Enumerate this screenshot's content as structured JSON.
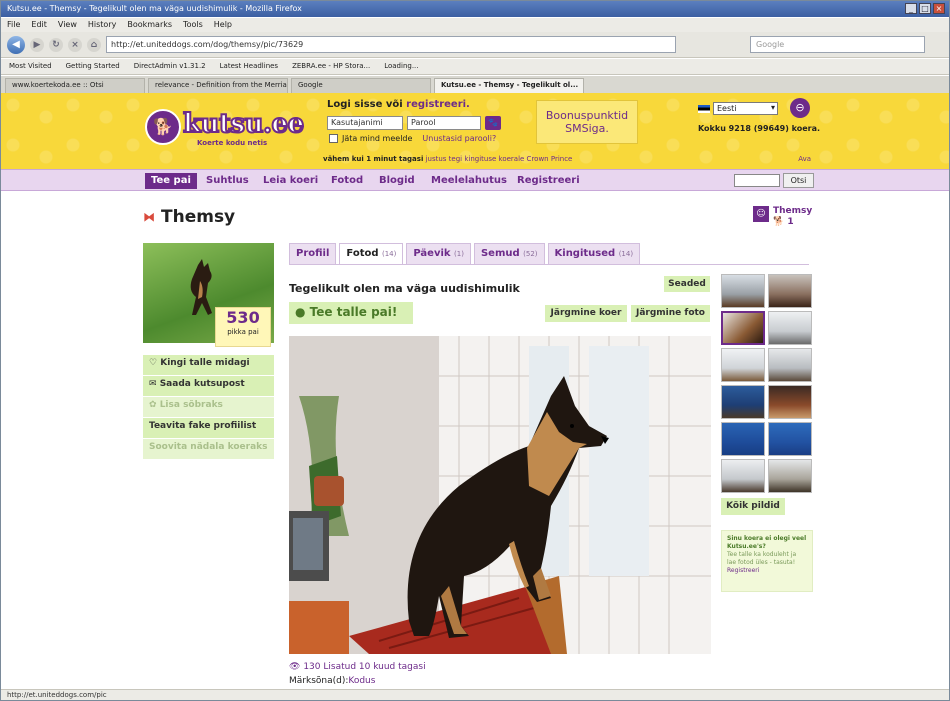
{
  "browser": {
    "title": "Kutsu.ee - Themsy - Tegelikult olen ma väga uudishimulik - Mozilla Firefox",
    "menu": [
      "File",
      "Edit",
      "View",
      "History",
      "Bookmarks",
      "Tools",
      "Help"
    ],
    "url": "http://et.uniteddogs.com/dog/themsy/pic/73629",
    "search_placeholder": "Google",
    "bookmarks": [
      "Most Visited",
      "Getting Started",
      "DirectAdmin v1.31.2",
      "Latest Headlines",
      "ZEBRA.ee - HP Stora...",
      "Loading..."
    ],
    "tabs": [
      "www.koertekoda.ee :: Otsi",
      "relevance - Definition from the Merriam...",
      "Google",
      "Kutsu.ee - Themsy - Tegelikult ol..."
    ],
    "status": "http://et.uniteddogs.com/pic"
  },
  "header": {
    "logo": "kutsu.ee",
    "tagline": "Koerte kodu netis",
    "login_title": "Logi sisse või",
    "register_link": "registreeri.",
    "username_placeholder": "Kasutajanimi",
    "password_placeholder": "Parool",
    "remember": "Jäta mind meelde",
    "forgot": "Unustasid parooli?",
    "bonus_line1": "Boonuspunktid",
    "bonus_line2": "SMSiga.",
    "language": "Eesti",
    "dog_count": "Kokku 9218 (99649) koera.",
    "ticker_time": "vähem kui 1 minut tagasi",
    "ticker_text": "justus tegi kingituse koerale Crown Prince",
    "ticker_more": "Ava"
  },
  "nav": {
    "items": [
      "Tee pai",
      "Suhtlus",
      "Leia koeri",
      "Fotod",
      "Blogid",
      "Meelelahutus",
      "Registreeri"
    ],
    "search_button": "Otsi"
  },
  "profile": {
    "name": "Themsy",
    "badge_name": "Themsy",
    "badge_count": "1",
    "score": "530",
    "score_label": "pikka pai",
    "actions": [
      "Kingi talle midagi",
      "Saada kutsupost",
      "Lisa sõbraks",
      "Teavita fake profiilist",
      "Soovita nädala koeraks"
    ]
  },
  "tabs": [
    {
      "label": "Profiil",
      "count": ""
    },
    {
      "label": "Fotod",
      "count": "(14)"
    },
    {
      "label": "Päevik",
      "count": "(1)"
    },
    {
      "label": "Semud",
      "count": "(52)"
    },
    {
      "label": "Kingitused",
      "count": "(14)"
    }
  ],
  "photo": {
    "title": "Tegelikult olen ma väga uudishimulik",
    "settings": "Seaded",
    "pet_button": "Tee talle pai!",
    "next_dog": "Järgmine koer",
    "next_photo": "Järgmine foto",
    "views": "130",
    "added": "Lisatud 10 kuud tagasi",
    "keywords_label": "Märksõna(d):",
    "keyword": "Kodus"
  },
  "sidebar": {
    "all_pics": "Kõik pildid",
    "promo_title": "Sinu koera ei olegi veel Kutsu.ee's?",
    "promo_text": "Tee talle ka koduleht ja lae fotod üles - tasuta!",
    "promo_link": "Registreeri"
  },
  "colors": {
    "brand_purple": "#6d2b8a",
    "banner_yellow": "#f8d83a",
    "action_green": "#d9f0b5"
  }
}
